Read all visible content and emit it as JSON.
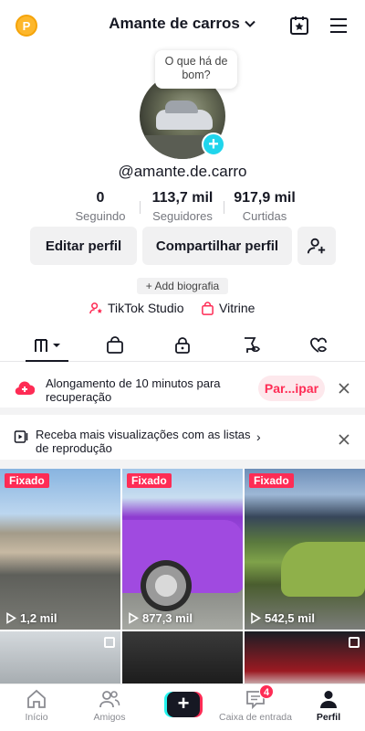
{
  "header": {
    "coin_label": "P",
    "title": "Amante de carros"
  },
  "profile": {
    "bubble_text": "O que há de bom?",
    "username": "@amante.de.carro",
    "stats": [
      {
        "value": "0",
        "label": "Seguindo"
      },
      {
        "value": "113,7 mil",
        "label": "Seguidores"
      },
      {
        "value": "917,9 mil",
        "label": "Curtidas"
      }
    ],
    "edit_label": "Editar perfil",
    "share_label": "Compartilhar perfil",
    "bio_label": "+ Add biografia",
    "studio_label": "TikTok Studio",
    "showcase_label": "Vitrine"
  },
  "banners": {
    "promo_text": "Alongamento de 10 minutos para recuperação",
    "promo_button": "Par...ipar",
    "playlist_text": "Receba mais visualizações com as listas de reprodução",
    "playlist_chevron": "›"
  },
  "videos": [
    {
      "pinned": "Fixado",
      "views": "1,2 mil"
    },
    {
      "pinned": "Fixado",
      "views": "877,3 mil"
    },
    {
      "pinned": "Fixado",
      "views": "542,5 mil"
    }
  ],
  "nav": {
    "home": "Início",
    "friends": "Amigos",
    "create": "+",
    "inbox": "Caixa de entrada",
    "inbox_badge": "4",
    "profile": "Perfil"
  },
  "colors": {
    "accent": "#fe2c55",
    "cyan": "#25f4ee",
    "text": "#161823",
    "muted": "#75777e"
  }
}
